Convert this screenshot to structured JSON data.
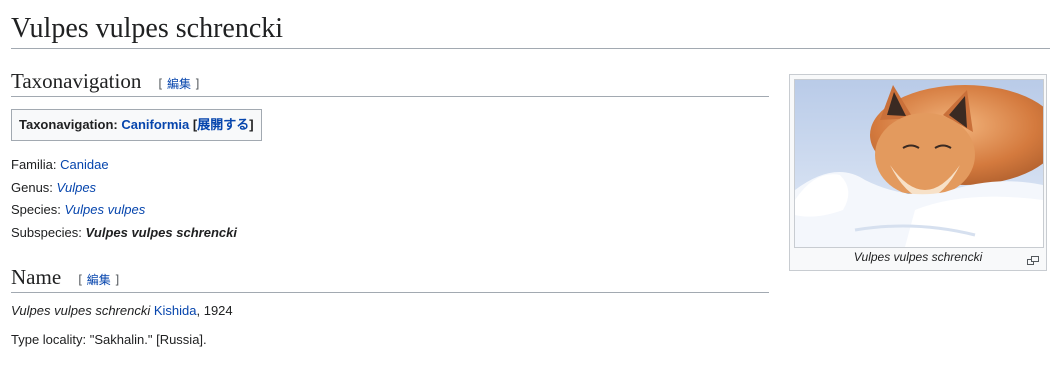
{
  "page": {
    "title": "Vulpes vulpes schrencki"
  },
  "sections": {
    "taxonavigation": {
      "heading": "Taxonavigation",
      "edit_open": "[",
      "edit_label": "編集",
      "edit_close": "]"
    },
    "name": {
      "heading": "Name",
      "edit_open": "[",
      "edit_label": "編集",
      "edit_close": "]"
    }
  },
  "taxobox": {
    "label": "Taxonavigation:",
    "link": "Caniformia",
    "expand_open": "[",
    "expand_label": "展開する",
    "expand_close": "]"
  },
  "ranks": [
    {
      "rank": "Familia:",
      "value": "Canidae"
    },
    {
      "rank": "Genus:",
      "value": "Vulpes"
    },
    {
      "rank": "Species:",
      "value": "Vulpes vulpes"
    },
    {
      "rank": "Subspecies:",
      "value": "Vulpes vulpes schrencki"
    }
  ],
  "name": {
    "taxon": "Vulpes vulpes schrencki",
    "author": "Kishida",
    "year": ", 1924",
    "type_locality": "Type locality: \"Sakhalin.\" [Russia]."
  },
  "thumbnail": {
    "caption": "Vulpes vulpes schrencki",
    "icon": "magnify-icon",
    "colors": {
      "sky": "#c9d8ef",
      "snow": "#f4f7fc",
      "fur": "#d9844a",
      "fur_light": "#f0c9a0",
      "dark": "#3a2a22"
    }
  }
}
